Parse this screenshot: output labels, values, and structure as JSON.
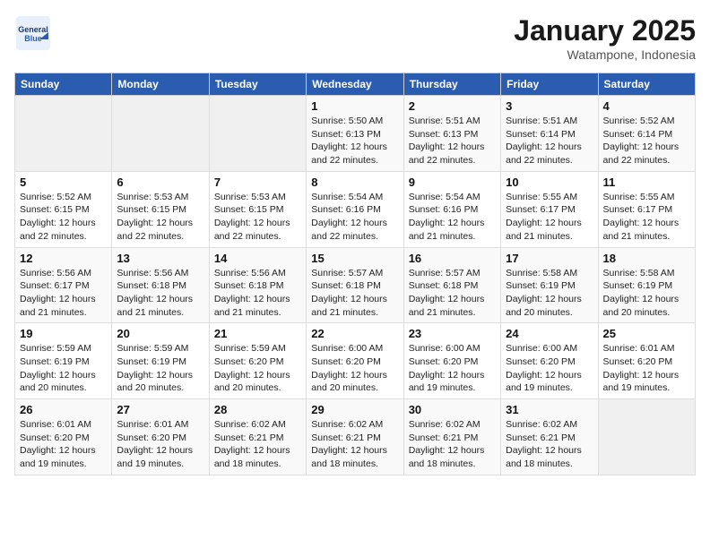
{
  "header": {
    "logo_text_1": "General",
    "logo_text_2": "Blue",
    "month": "January 2025",
    "location": "Watampone, Indonesia"
  },
  "columns": [
    "Sunday",
    "Monday",
    "Tuesday",
    "Wednesday",
    "Thursday",
    "Friday",
    "Saturday"
  ],
  "weeks": [
    [
      {
        "day": "",
        "sunrise": "",
        "sunset": "",
        "daylight": "",
        "empty": true
      },
      {
        "day": "",
        "sunrise": "",
        "sunset": "",
        "daylight": "",
        "empty": true
      },
      {
        "day": "",
        "sunrise": "",
        "sunset": "",
        "daylight": "",
        "empty": true
      },
      {
        "day": "1",
        "sunrise": "Sunrise: 5:50 AM",
        "sunset": "Sunset: 6:13 PM",
        "daylight": "Daylight: 12 hours and 22 minutes."
      },
      {
        "day": "2",
        "sunrise": "Sunrise: 5:51 AM",
        "sunset": "Sunset: 6:13 PM",
        "daylight": "Daylight: 12 hours and 22 minutes."
      },
      {
        "day": "3",
        "sunrise": "Sunrise: 5:51 AM",
        "sunset": "Sunset: 6:14 PM",
        "daylight": "Daylight: 12 hours and 22 minutes."
      },
      {
        "day": "4",
        "sunrise": "Sunrise: 5:52 AM",
        "sunset": "Sunset: 6:14 PM",
        "daylight": "Daylight: 12 hours and 22 minutes."
      }
    ],
    [
      {
        "day": "5",
        "sunrise": "Sunrise: 5:52 AM",
        "sunset": "Sunset: 6:15 PM",
        "daylight": "Daylight: 12 hours and 22 minutes."
      },
      {
        "day": "6",
        "sunrise": "Sunrise: 5:53 AM",
        "sunset": "Sunset: 6:15 PM",
        "daylight": "Daylight: 12 hours and 22 minutes."
      },
      {
        "day": "7",
        "sunrise": "Sunrise: 5:53 AM",
        "sunset": "Sunset: 6:15 PM",
        "daylight": "Daylight: 12 hours and 22 minutes."
      },
      {
        "day": "8",
        "sunrise": "Sunrise: 5:54 AM",
        "sunset": "Sunset: 6:16 PM",
        "daylight": "Daylight: 12 hours and 22 minutes."
      },
      {
        "day": "9",
        "sunrise": "Sunrise: 5:54 AM",
        "sunset": "Sunset: 6:16 PM",
        "daylight": "Daylight: 12 hours and 21 minutes."
      },
      {
        "day": "10",
        "sunrise": "Sunrise: 5:55 AM",
        "sunset": "Sunset: 6:17 PM",
        "daylight": "Daylight: 12 hours and 21 minutes."
      },
      {
        "day": "11",
        "sunrise": "Sunrise: 5:55 AM",
        "sunset": "Sunset: 6:17 PM",
        "daylight": "Daylight: 12 hours and 21 minutes."
      }
    ],
    [
      {
        "day": "12",
        "sunrise": "Sunrise: 5:56 AM",
        "sunset": "Sunset: 6:17 PM",
        "daylight": "Daylight: 12 hours and 21 minutes."
      },
      {
        "day": "13",
        "sunrise": "Sunrise: 5:56 AM",
        "sunset": "Sunset: 6:18 PM",
        "daylight": "Daylight: 12 hours and 21 minutes."
      },
      {
        "day": "14",
        "sunrise": "Sunrise: 5:56 AM",
        "sunset": "Sunset: 6:18 PM",
        "daylight": "Daylight: 12 hours and 21 minutes."
      },
      {
        "day": "15",
        "sunrise": "Sunrise: 5:57 AM",
        "sunset": "Sunset: 6:18 PM",
        "daylight": "Daylight: 12 hours and 21 minutes."
      },
      {
        "day": "16",
        "sunrise": "Sunrise: 5:57 AM",
        "sunset": "Sunset: 6:18 PM",
        "daylight": "Daylight: 12 hours and 21 minutes."
      },
      {
        "day": "17",
        "sunrise": "Sunrise: 5:58 AM",
        "sunset": "Sunset: 6:19 PM",
        "daylight": "Daylight: 12 hours and 20 minutes."
      },
      {
        "day": "18",
        "sunrise": "Sunrise: 5:58 AM",
        "sunset": "Sunset: 6:19 PM",
        "daylight": "Daylight: 12 hours and 20 minutes."
      }
    ],
    [
      {
        "day": "19",
        "sunrise": "Sunrise: 5:59 AM",
        "sunset": "Sunset: 6:19 PM",
        "daylight": "Daylight: 12 hours and 20 minutes."
      },
      {
        "day": "20",
        "sunrise": "Sunrise: 5:59 AM",
        "sunset": "Sunset: 6:19 PM",
        "daylight": "Daylight: 12 hours and 20 minutes."
      },
      {
        "day": "21",
        "sunrise": "Sunrise: 5:59 AM",
        "sunset": "Sunset: 6:20 PM",
        "daylight": "Daylight: 12 hours and 20 minutes."
      },
      {
        "day": "22",
        "sunrise": "Sunrise: 6:00 AM",
        "sunset": "Sunset: 6:20 PM",
        "daylight": "Daylight: 12 hours and 20 minutes."
      },
      {
        "day": "23",
        "sunrise": "Sunrise: 6:00 AM",
        "sunset": "Sunset: 6:20 PM",
        "daylight": "Daylight: 12 hours and 19 minutes."
      },
      {
        "day": "24",
        "sunrise": "Sunrise: 6:00 AM",
        "sunset": "Sunset: 6:20 PM",
        "daylight": "Daylight: 12 hours and 19 minutes."
      },
      {
        "day": "25",
        "sunrise": "Sunrise: 6:01 AM",
        "sunset": "Sunset: 6:20 PM",
        "daylight": "Daylight: 12 hours and 19 minutes."
      }
    ],
    [
      {
        "day": "26",
        "sunrise": "Sunrise: 6:01 AM",
        "sunset": "Sunset: 6:20 PM",
        "daylight": "Daylight: 12 hours and 19 minutes."
      },
      {
        "day": "27",
        "sunrise": "Sunrise: 6:01 AM",
        "sunset": "Sunset: 6:20 PM",
        "daylight": "Daylight: 12 hours and 19 minutes."
      },
      {
        "day": "28",
        "sunrise": "Sunrise: 6:02 AM",
        "sunset": "Sunset: 6:21 PM",
        "daylight": "Daylight: 12 hours and 18 minutes."
      },
      {
        "day": "29",
        "sunrise": "Sunrise: 6:02 AM",
        "sunset": "Sunset: 6:21 PM",
        "daylight": "Daylight: 12 hours and 18 minutes."
      },
      {
        "day": "30",
        "sunrise": "Sunrise: 6:02 AM",
        "sunset": "Sunset: 6:21 PM",
        "daylight": "Daylight: 12 hours and 18 minutes."
      },
      {
        "day": "31",
        "sunrise": "Sunrise: 6:02 AM",
        "sunset": "Sunset: 6:21 PM",
        "daylight": "Daylight: 12 hours and 18 minutes."
      },
      {
        "day": "",
        "sunrise": "",
        "sunset": "",
        "daylight": "",
        "empty": true
      }
    ]
  ]
}
